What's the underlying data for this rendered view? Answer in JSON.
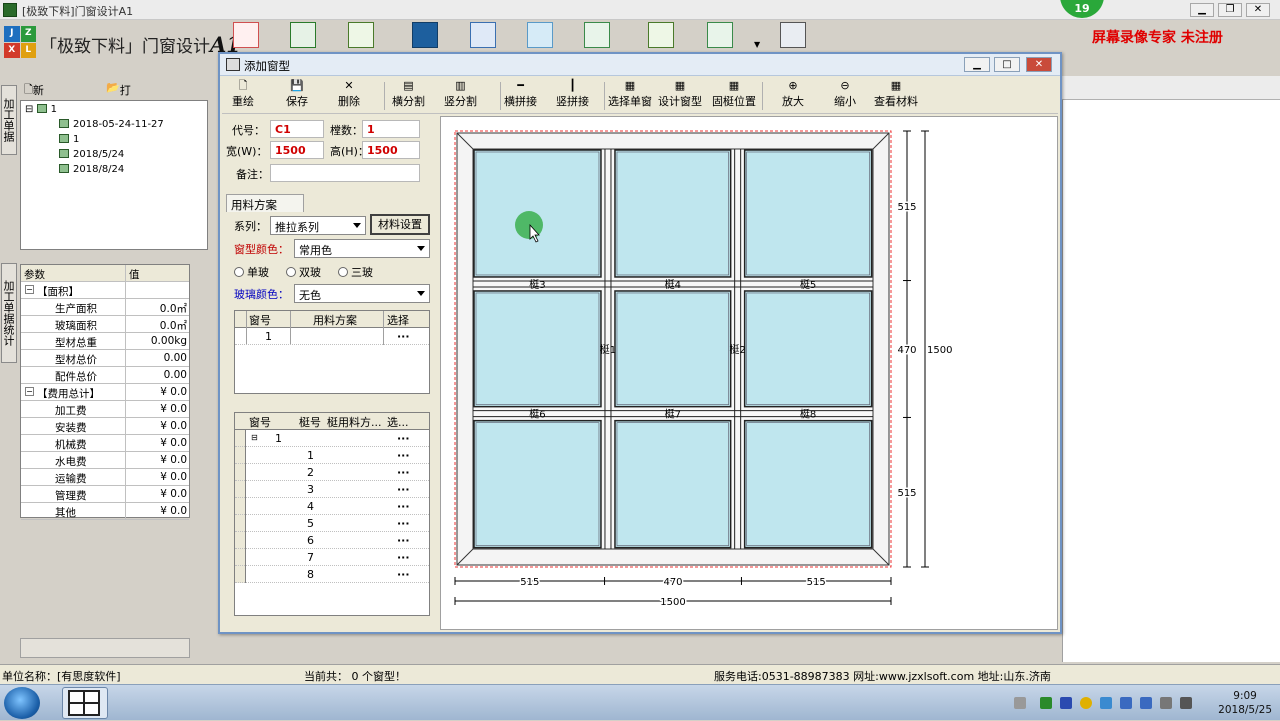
{
  "window": {
    "title": "[极致下料]门窗设计A1"
  },
  "badge": "19",
  "watermark": "屏幕录像专家  未注册",
  "logo": {
    "letters": [
      "J",
      "Z",
      "X",
      "L"
    ],
    "name": "「极致下料」门窗设计",
    "suffix": "A1"
  },
  "left": {
    "tabs": [
      "加工单据",
      "加工单据统计"
    ],
    "tree_toolbar": {
      "new": "新建加工单",
      "open": "打开单据"
    },
    "tree": [
      {
        "label": "1",
        "level": 0
      },
      {
        "label": "2018-05-24-11-27",
        "level": 1
      },
      {
        "label": "1",
        "level": 1
      },
      {
        "label": "2018/5/24",
        "level": 1
      },
      {
        "label": "2018/8/24",
        "level": 1
      }
    ],
    "params": {
      "header": [
        "参数",
        "值"
      ],
      "rows": [
        {
          "label": "【面积】",
          "value": "",
          "group": true
        },
        {
          "label": "生产面积",
          "value": "0.0㎡"
        },
        {
          "label": "玻璃面积",
          "value": "0.0㎡"
        },
        {
          "label": "型材总重",
          "value": "0.00kg"
        },
        {
          "label": "型材总价",
          "value": "0.00"
        },
        {
          "label": "配件总价",
          "value": "0.00"
        },
        {
          "label": "【费用总计】",
          "value": "¥ 0.0",
          "group": true
        },
        {
          "label": "加工费",
          "value": "¥ 0.0"
        },
        {
          "label": "安装费",
          "value": "¥ 0.0"
        },
        {
          "label": "机械费",
          "value": "¥ 0.0"
        },
        {
          "label": "水电费",
          "value": "¥ 0.0"
        },
        {
          "label": "运输费",
          "value": "¥ 0.0"
        },
        {
          "label": "管理费",
          "value": "¥ 0.0"
        },
        {
          "label": "其他",
          "value": "¥ 0.0"
        }
      ]
    }
  },
  "dialog": {
    "title": "添加窗型",
    "toolbar": [
      "重绘",
      "保存",
      "删除",
      "横分割",
      "竖分割",
      "横拼接",
      "竖拼接",
      "选择单窗",
      "设计窗型",
      "固梃位置",
      "放大",
      "缩小",
      "查看材料"
    ],
    "form": {
      "code_label": "代号：",
      "code": "C1",
      "count_label": "樘数：",
      "count": "1",
      "width_label": "宽(W)：",
      "width": "1500",
      "height_label": "高(H)：",
      "height": "1500",
      "note_label": "备注：",
      "note": ""
    },
    "scheme": {
      "tab": "用料方案",
      "series_label": "系列：",
      "series": "推拉系列",
      "material_btn": "材料设置",
      "frame_color_label": "窗型颜色：",
      "frame_color": "常用色",
      "glass_options": [
        "单玻",
        "双玻",
        "三玻"
      ],
      "glass_color_label": "玻璃颜色：",
      "glass_color": "无色"
    },
    "grid1": {
      "headers": [
        "窗号",
        "用料方案",
        "选择"
      ],
      "rows": [
        {
          "no": "1",
          "scheme": "",
          "pick": "···"
        }
      ]
    },
    "grid2": {
      "headers": [
        "窗号",
        "梃号",
        "梃用料方...",
        "选..."
      ],
      "group": "1",
      "rows": [
        "1",
        "2",
        "3",
        "4",
        "5",
        "6",
        "7",
        "8"
      ],
      "pick": "···"
    },
    "drawing": {
      "mullion_labels": [
        "梃1",
        "梃2",
        "梃3",
        "梃4",
        "梃5",
        "梃6",
        "梃7",
        "梃8"
      ],
      "bottom_dims": [
        "515",
        "470",
        "515"
      ],
      "total_width": "1500",
      "right_dims": [
        "515",
        "470",
        "515"
      ],
      "total_height": "1500"
    }
  },
  "status": {
    "unit": "单位名称：[有思度软件]",
    "count": "当前共：  0 个窗型！",
    "contact": "服务电话:0531-88987383   网址:www.jzxlsoft.com  地址:山东.济南"
  },
  "taskbar": {
    "time": "9:09",
    "date": "2018/5/25"
  }
}
